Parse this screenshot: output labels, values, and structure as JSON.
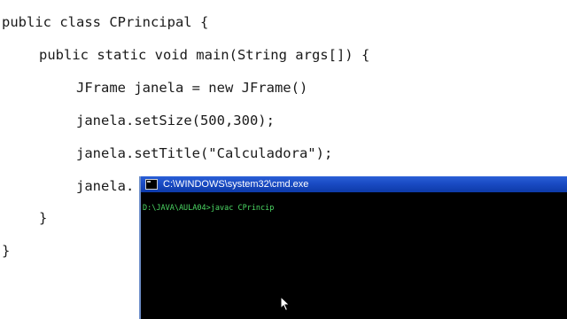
{
  "editor": {
    "lines": [
      "public class CPrincipal {",
      "public static void main(String args[]) {",
      "JFrame janela = new JFrame()",
      "janela.setSize(500,300);",
      "janela.setTitle(\"Calculadora\");",
      "janela.",
      "}",
      "}"
    ]
  },
  "cmd_window": {
    "title": "C:\\WINDOWS\\system32\\cmd.exe",
    "prompt_line": "D:\\JAVA\\AULA04>javac CPrincip"
  },
  "colors": {
    "titlebar": "#1a4bc4",
    "console_text": "#4cd964",
    "console_bg": "#000000"
  }
}
